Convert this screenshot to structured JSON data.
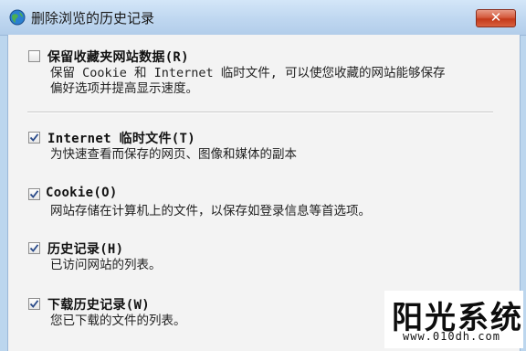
{
  "window": {
    "title": "删除浏览的历史记录",
    "close_label": "✕"
  },
  "options": [
    {
      "label": "保留收藏夹网站数据(R)",
      "description": [
        "保留 Cookie 和 Internet 临时文件, 可以使您收藏的网站能够保存",
        "偏好选项并提高显示速度。"
      ],
      "checked": false
    },
    {
      "label": "Internet 临时文件(T)",
      "description": [
        "为快速查看而保存的网页、图像和媒体的副本"
      ],
      "checked": true
    },
    {
      "label": "Cookie(O)",
      "description": [
        "网站存储在计算机上的文件，以保存如登录信息等首选项。"
      ],
      "checked": true
    },
    {
      "label": "历史记录(H)",
      "description": [
        "已访问网站的列表。"
      ],
      "checked": true
    },
    {
      "label": "下载历史记录(W)",
      "description": [
        "您已下载的文件的列表。"
      ],
      "checked": true
    }
  ],
  "watermark": {
    "title": "阳光系统",
    "url": "www.010dh.com"
  },
  "colors": {
    "title_bar": "#c4dbf2",
    "close_button": "#d04a2c",
    "panel": "#f3f3f3",
    "check": "#2a4b8a"
  }
}
